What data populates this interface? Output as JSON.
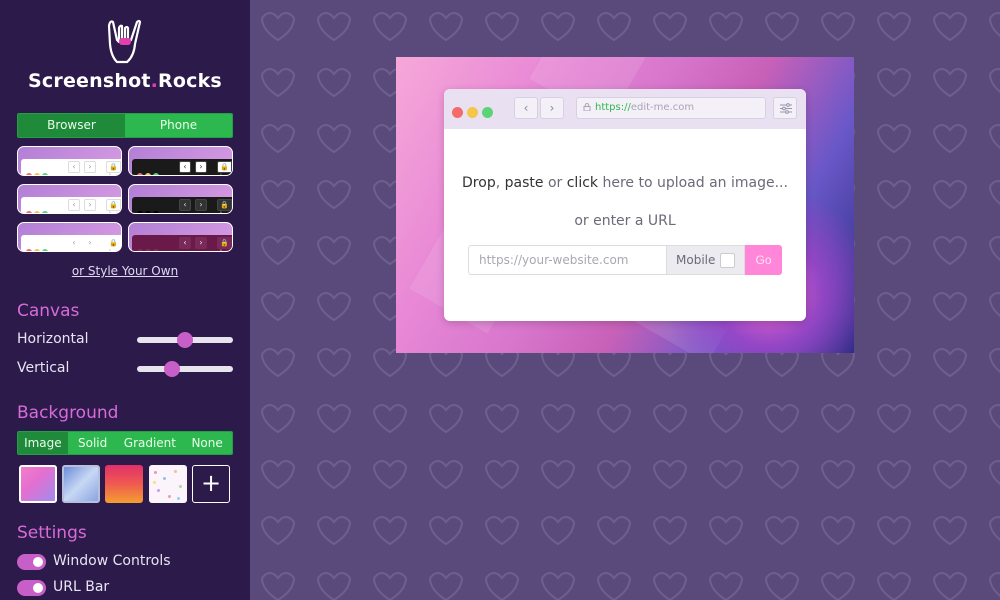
{
  "brand": {
    "name_main": "Screenshot",
    "name_dot": ".",
    "name_suffix": "Rocks"
  },
  "mode_tabs": [
    {
      "label": "Browser",
      "active": true
    },
    {
      "label": "Phone",
      "active": false
    }
  ],
  "style_link": "or Style Your Own",
  "canvas": {
    "title": "Canvas",
    "horizontal_label": "Horizontal",
    "horizontal_value": 0.5,
    "vertical_label": "Vertical",
    "vertical_value": 0.36
  },
  "background": {
    "title": "Background",
    "tabs": [
      {
        "label": "Image",
        "active": true
      },
      {
        "label": "Solid",
        "active": false
      },
      {
        "label": "Gradient",
        "active": false
      },
      {
        "label": "None",
        "active": false
      }
    ],
    "add_label": "+"
  },
  "settings": {
    "title": "Settings",
    "window_controls": "Window Controls",
    "url_bar": "URL Bar"
  },
  "browser": {
    "url_protocol": "https://",
    "url_host": "edit-me.com",
    "drop_word1": "Drop",
    "drop_sep1": ",",
    "drop_word2": "paste",
    "drop_or": " or ",
    "drop_word3": "click",
    "drop_rest": " here to upload an image...",
    "or_enter": "or enter a URL",
    "url_placeholder": "https://your-website.com",
    "mobile_label": "Mobile",
    "go_label": "Go"
  },
  "colors": {
    "sidebar_bg": "#2b1a4a",
    "main_bg": "#5a4a7c",
    "accent_green": "#2db84f",
    "accent_pink": "#d86bd8",
    "go_pink": "#ff86d8"
  }
}
